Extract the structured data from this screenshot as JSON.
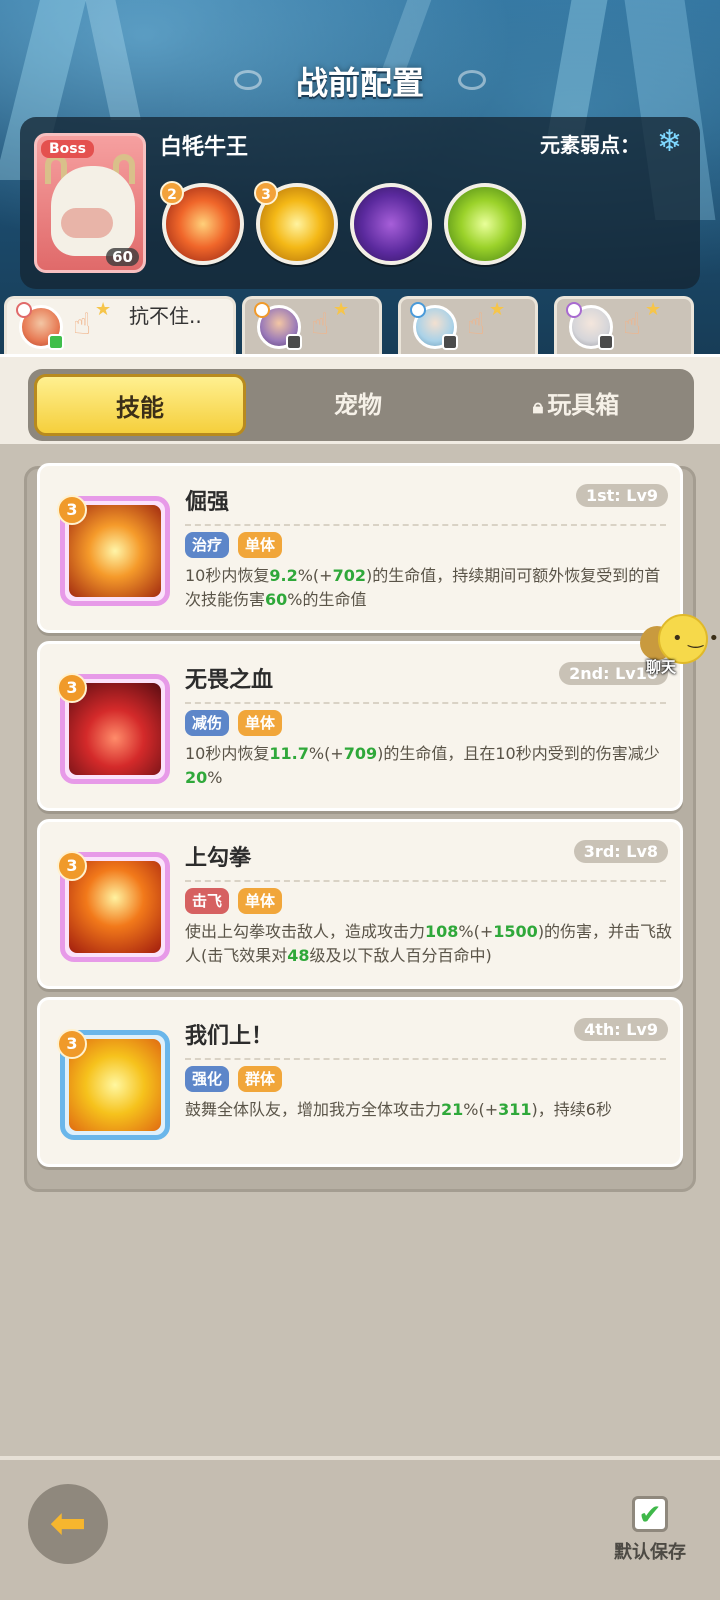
{
  "header": {
    "title": "战前配置"
  },
  "boss": {
    "badge": "Boss",
    "name": "白牦牛王",
    "level": "60",
    "weakness_label": "元素弱点：",
    "weakness_icon": "snowflake-icon",
    "skills": [
      {
        "badge": "2",
        "icon": "fire-phoenix-icon"
      },
      {
        "badge": "3",
        "icon": "golden-swirl-icon"
      },
      {
        "badge": "",
        "icon": "purple-monster-icon"
      },
      {
        "badge": "",
        "icon": "green-monster-icon"
      }
    ]
  },
  "team": {
    "members": [
      {
        "text": "抗不住..",
        "online": true
      },
      {
        "text": "",
        "online": false
      },
      {
        "text": "",
        "online": false
      },
      {
        "text": "",
        "online": false
      }
    ]
  },
  "tabs": {
    "skill": "技能",
    "pet": "宠物",
    "toybox": "玩具箱"
  },
  "skills": [
    {
      "name": "倔强",
      "slot": "1st: Lv9",
      "badge": "3",
      "tags": [
        "治疗",
        "单体"
      ],
      "desc": [
        "10秒内恢复",
        "9.2",
        "%(+",
        "702",
        ")的生命值，持续期间可额外恢复受到的首次技能伤害",
        "60",
        "%的生命值"
      ]
    },
    {
      "name": "无畏之血",
      "slot": "2nd: Lv10",
      "badge": "3",
      "tags": [
        "减伤",
        "单体"
      ],
      "desc": [
        "10秒内恢复",
        "11.7",
        "%(+",
        "709",
        ")的生命值，且在10秒内受到的伤害减少",
        "20",
        "%"
      ]
    },
    {
      "name": "上勾拳",
      "slot": "3rd: Lv8",
      "badge": "3",
      "tags": [
        "击飞",
        "单体"
      ],
      "desc": [
        "使出上勾拳攻击敌人，造成攻击力",
        "108",
        "%(+",
        "1500",
        ")的伤害，并击飞敌人(击飞效果对",
        "48",
        "级及以下敌人百分百命中)"
      ]
    },
    {
      "name": "我们上！",
      "slot": "4th: Lv9",
      "badge": "3",
      "tags": [
        "强化",
        "群体"
      ],
      "desc": [
        "鼓舞全体队友，增加我方全体攻击力",
        "21",
        "%(+",
        "311",
        ")，持续6秒"
      ]
    }
  ],
  "chat": {
    "label": "聊天"
  },
  "footer": {
    "save_label": "默认保存",
    "save_checked": true
  }
}
